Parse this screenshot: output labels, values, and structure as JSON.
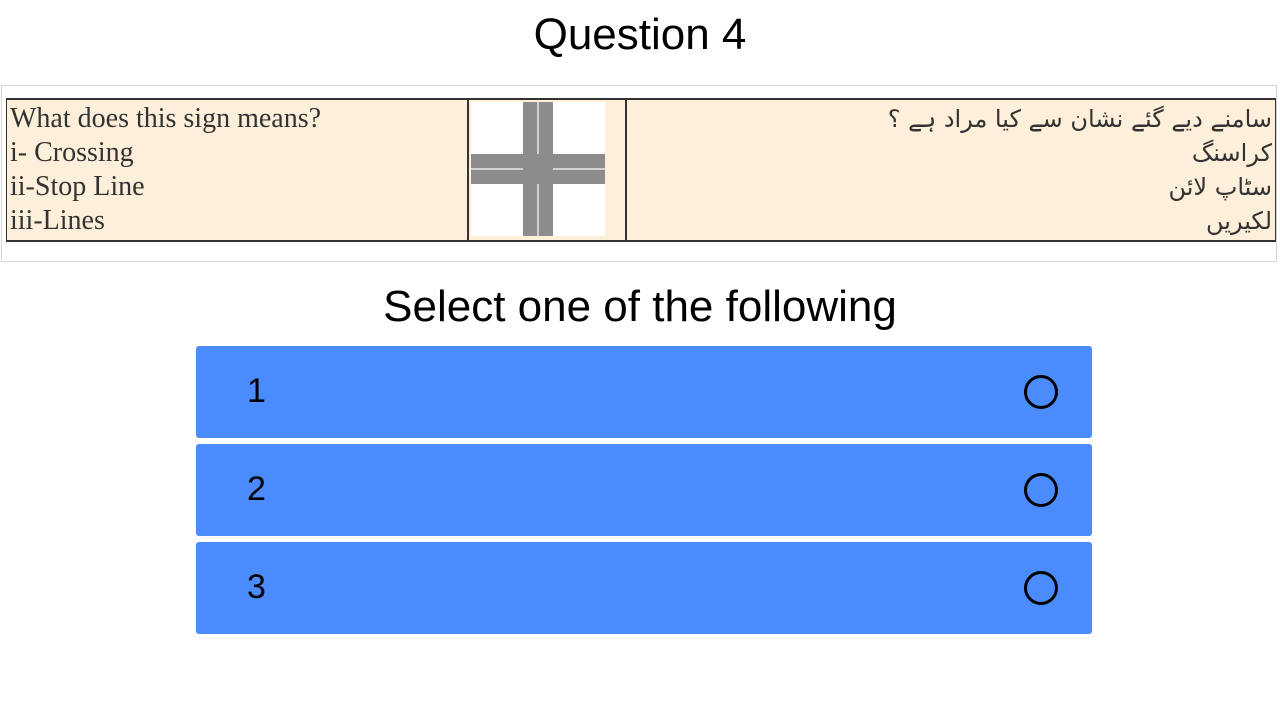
{
  "header": {
    "title": "Question 4"
  },
  "question": {
    "english_lines": [
      "What does this sign means?",
      "i- Crossing",
      "ii-Stop Line",
      "iii-Lines"
    ],
    "urdu_lines": [
      "سامنے دیے گئے نشان سے کیا مراد ہے ؟",
      "کراسنگ",
      "سٹاپ لائن",
      "لکیریں"
    ],
    "sign_icon": "crossing-sign-icon"
  },
  "prompt": {
    "text": "Select one of the following"
  },
  "options": [
    {
      "label": "1",
      "selected": false
    },
    {
      "label": "2",
      "selected": false
    },
    {
      "label": "3",
      "selected": false
    }
  ],
  "colors": {
    "option_background": "#4a8cfd",
    "question_background": "#feefda"
  }
}
